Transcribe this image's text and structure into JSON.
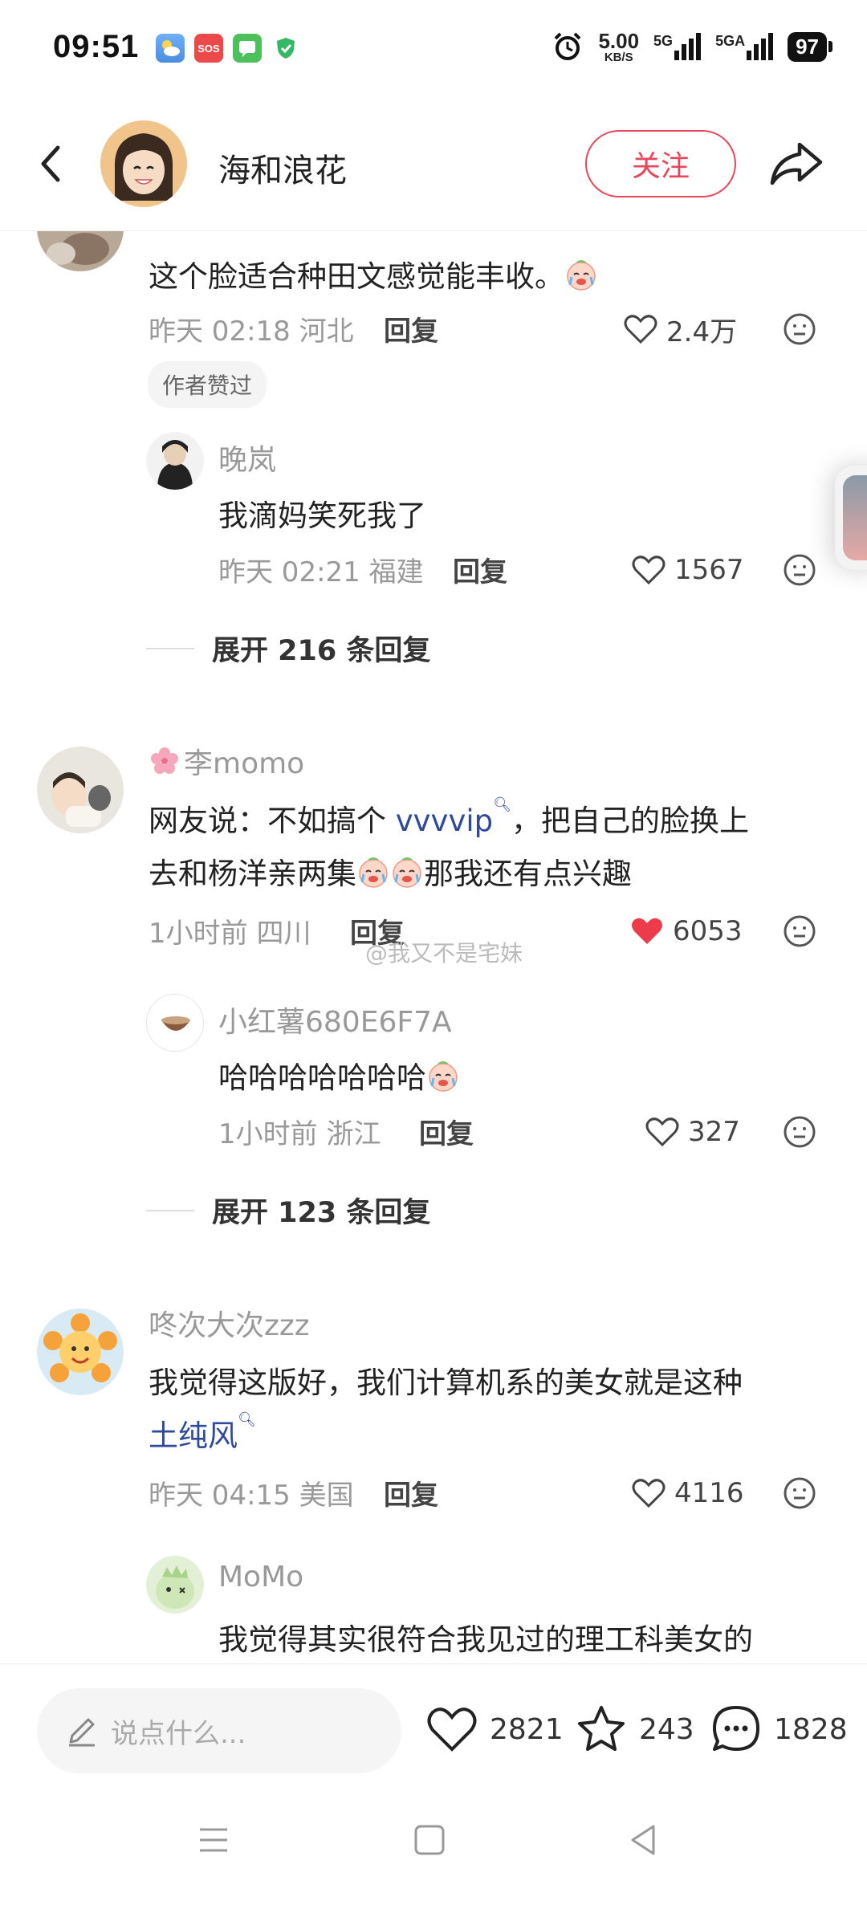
{
  "status_bar": {
    "time": "09:51",
    "net_speed_value": "5.00",
    "net_speed_unit": "KB/S",
    "net_label_1": "5G",
    "net_label_2": "5GA",
    "battery": "97",
    "app_icons": [
      "weather-icon",
      "sos-icon",
      "messages-icon",
      "shield-icon"
    ]
  },
  "header": {
    "author_name": "海和浪花",
    "follow_label": "关注",
    "accent_color": "#e8475a"
  },
  "comments": [
    {
      "text": "这个脸适合种田文感觉能丰收。",
      "meta": "昨天 02:18 河北",
      "reply_label": "回复",
      "likes": "2.4万",
      "liked": false,
      "badge": "作者赞过",
      "replies": [
        {
          "user": "晚岚",
          "text": "我滴妈笑死我了",
          "meta": "昨天 02:21 福建",
          "reply_label": "回复",
          "likes": "1567"
        }
      ],
      "expand_label": "展开 216 条回复"
    },
    {
      "user": "李momo",
      "text_line1_prefix": "网友说：不如搞个 ",
      "text_link": "vvvvip",
      "text_line1_suffix": "，把自己的脸换上",
      "text_line2_prefix": "去和杨洋亲两集",
      "text_line2_suffix": "那我还有点兴趣",
      "meta": "1小时前 四川",
      "reply_label": "回复",
      "likes": "6053",
      "liked": true,
      "replies": [
        {
          "user": "小红薯680E6F7A",
          "text": "哈哈哈哈哈哈哈",
          "meta": "1小时前 浙江",
          "reply_label": "回复",
          "likes": "327"
        }
      ],
      "expand_label": "展开 123 条回复"
    },
    {
      "user": "咚次大次zzz",
      "text_line1": "我觉得这版好，我们计算机系的美女就是这种",
      "text_link": "土纯风",
      "meta": "昨天 04:15 美国",
      "reply_label": "回复",
      "likes": "4116",
      "liked": false,
      "replies": [
        {
          "user": "MoMo",
          "text": "我觉得其实很符合我见过的理工科美女的"
        }
      ]
    }
  ],
  "watermark": "@我又不是宅妹",
  "bottom_bar": {
    "input_placeholder": "说点什么...",
    "like_count": "2821",
    "collect_count": "243",
    "comment_count": "1828"
  }
}
